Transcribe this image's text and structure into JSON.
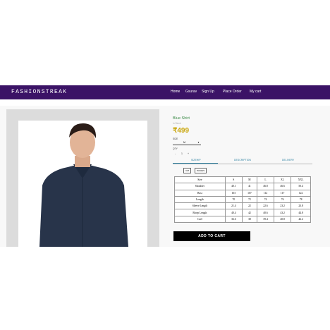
{
  "navbar": {
    "brand": "FASHIONSTREAK",
    "links": [
      "Home",
      "Gsurav",
      "Sign Up",
      "Place Order",
      "My cart"
    ]
  },
  "product": {
    "title": "Blue Shirt",
    "stock": "In Stock",
    "price": "₹499",
    "size_label": "SIZE",
    "size_value": "M",
    "qty_label": "QTY",
    "qty_value": "1"
  },
  "tabs": [
    "SIZEHIP",
    "DESCRIPTION",
    "DELIVERY"
  ],
  "unit_buttons": [
    "CM",
    "INCHES"
  ],
  "size_chart": {
    "headers": [
      "Size",
      "S",
      "M",
      "L",
      "XL",
      "XXL"
    ],
    "rows": [
      [
        "Shoulder",
        "40.1",
        "41",
        "46.8",
        "46.6",
        "50.4"
      ],
      [
        "Bust",
        "103",
        "107",
        "112",
        "117",
        "122"
      ],
      [
        "Length",
        "70",
        "72",
        "74",
        "76",
        "78"
      ],
      [
        "Sleeve Length",
        "21.4",
        "22",
        "22.6",
        "23.2",
        "23.8"
      ],
      [
        "Bicep Length",
        "40.4",
        "42",
        "40.6",
        "43.2",
        "44.8"
      ],
      [
        "Cuff",
        "36.6",
        "38",
        "39.4",
        "40.8",
        "42.2"
      ]
    ]
  },
  "cart": {
    "label": "ADD TO CART"
  },
  "colors": {
    "navbar": "#3b1366",
    "price": "#c9a60c",
    "title": "#3a8a46",
    "shirt": "#28344a"
  }
}
